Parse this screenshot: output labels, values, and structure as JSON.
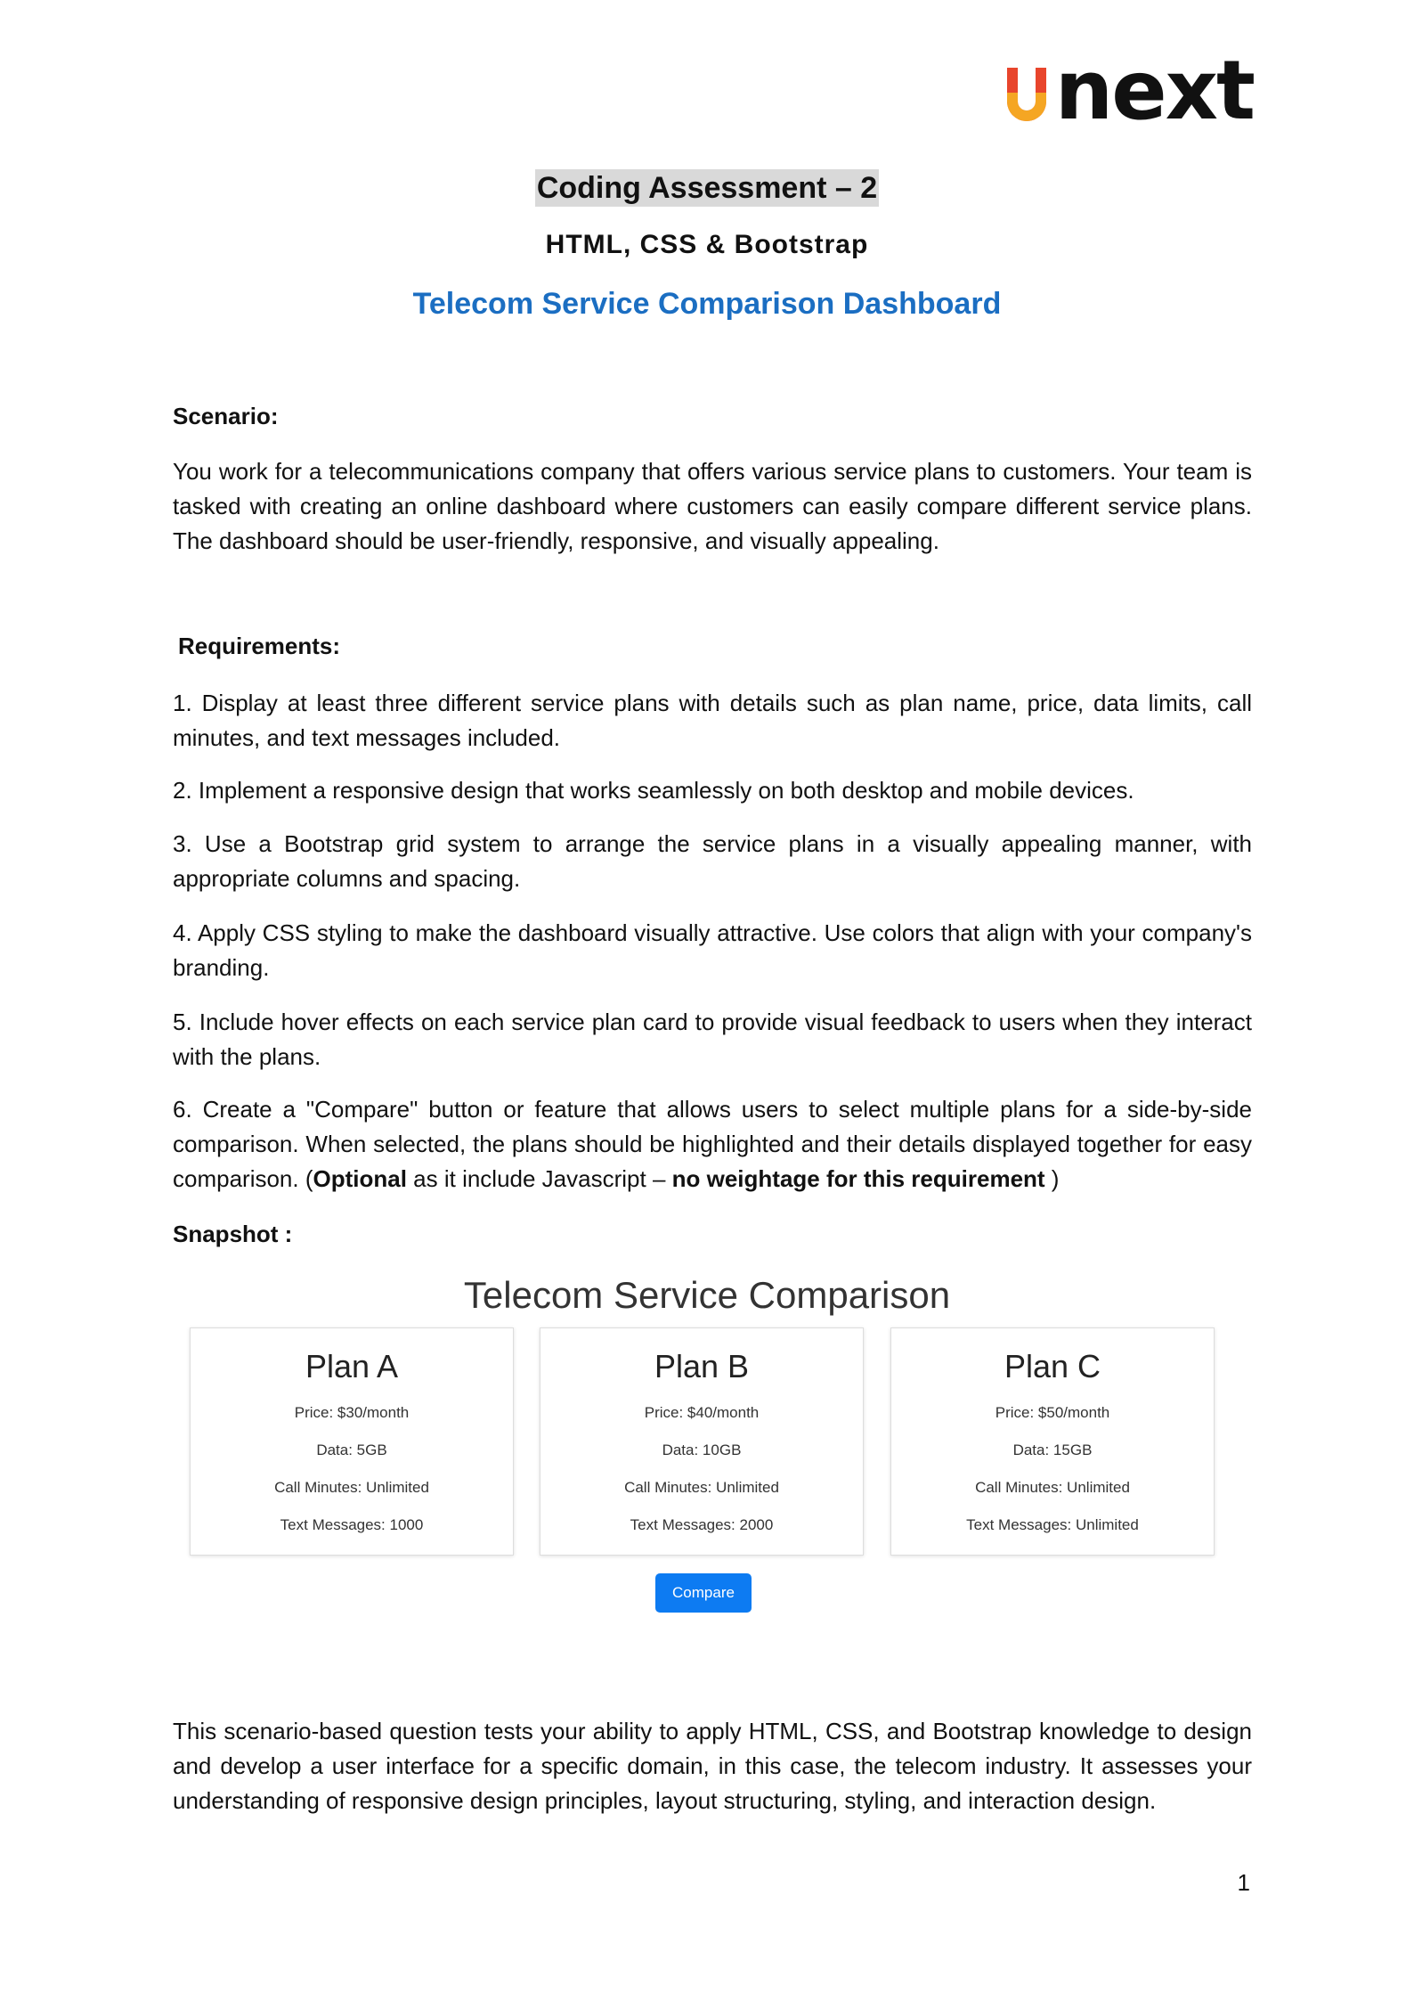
{
  "logo": {
    "text": "next",
    "colors": {
      "u_top": "#e8452c",
      "u_bottom": "#f5a623"
    }
  },
  "doc": {
    "title": "Coding Assessment – 2",
    "subtitle": "HTML, CSS & Bootstrap",
    "heading": "Telecom Service Comparison Dashboard",
    "scenario_label": "Scenario:",
    "scenario_text": "You work for a telecommunications company that offers various service plans to customers. Your team is tasked with creating an online dashboard where customers can easily compare different service plans. The dashboard should be user-friendly, responsive, and visually appealing.",
    "requirements_label": "Requirements:",
    "requirements": [
      "1. Display at least three different service plans with details such as plan name, price, data limits, call minutes, and text messages included.",
      "2. Implement a responsive design that works seamlessly on both desktop and mobile devices.",
      "3. Use a Bootstrap grid system to arrange the service plans in a visually appealing manner, with appropriate columns and spacing.",
      "4. Apply CSS styling to make the dashboard visually attractive. Use colors that align with your company's branding.",
      "5. Include hover effects on each service plan card to provide visual feedback to users when they interact with the plans."
    ],
    "req6": {
      "text": "6. Create a \"Compare\" button or feature that allows users to select multiple plans for a side-by-side comparison. When selected, the plans should be highlighted and their details displayed together for easy comparison. (",
      "optional": "Optional",
      "middle": " as it include Javascript – ",
      "no_weight": "no weightage for this requirement",
      "end": " )"
    },
    "snapshot_label": "Snapshot :",
    "closing": "This scenario-based question tests your ability to apply HTML, CSS, and Bootstrap knowledge to design and develop a user interface for a specific domain, in this case, the telecom industry. It assesses your understanding of responsive design principles, layout structuring, styling, and interaction design.",
    "page_number": "1"
  },
  "snapshot": {
    "title": "Telecom Service Comparison",
    "plans": [
      {
        "name": "Plan A",
        "price": "Price: $30/month",
        "data": "Data: 5GB",
        "calls": "Call Minutes: Unlimited",
        "texts": "Text Messages: 1000"
      },
      {
        "name": "Plan B",
        "price": "Price: $40/month",
        "data": "Data: 10GB",
        "calls": "Call Minutes: Unlimited",
        "texts": "Text Messages: 2000"
      },
      {
        "name": "Plan C",
        "price": "Price: $50/month",
        "data": "Data: 15GB",
        "calls": "Call Minutes: Unlimited",
        "texts": "Text Messages: Unlimited"
      }
    ],
    "compare_label": "Compare",
    "compare_color": "#0d7bf2"
  }
}
